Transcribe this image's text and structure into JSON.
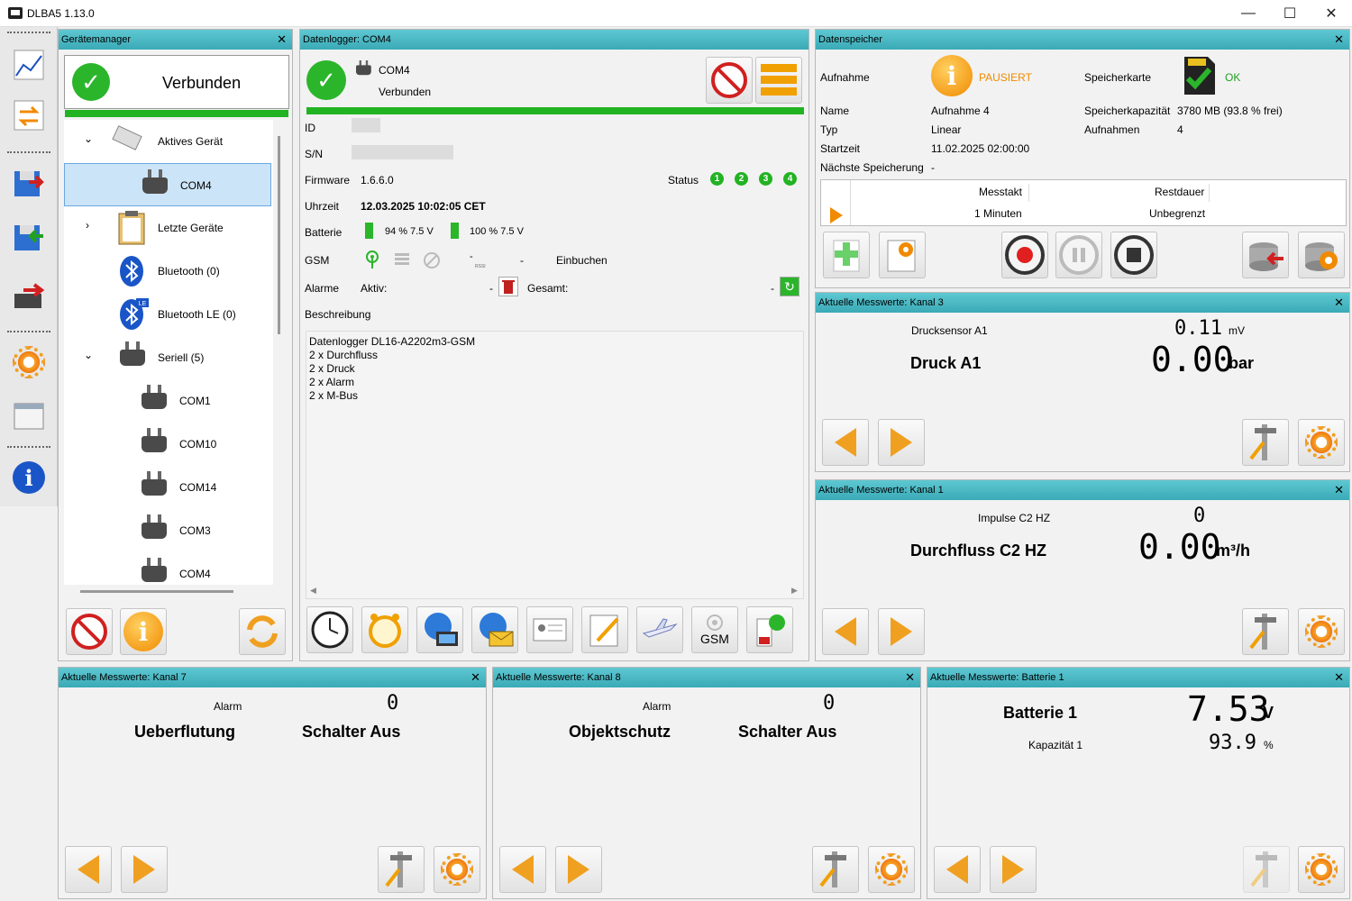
{
  "window": {
    "title": "DLBA5 1.13.0"
  },
  "device_manager": {
    "title": "Gerätemanager",
    "status": "Verbunden",
    "tree": [
      {
        "label": "Aktives Gerät"
      },
      {
        "label": "COM4"
      },
      {
        "label": "Letzte Geräte"
      },
      {
        "label": "Bluetooth (0)"
      },
      {
        "label": "Bluetooth LE (0)"
      },
      {
        "label": "Seriell (5)"
      },
      {
        "label": "COM1"
      },
      {
        "label": "COM10"
      },
      {
        "label": "COM14"
      },
      {
        "label": "COM3"
      },
      {
        "label": "COM4"
      }
    ]
  },
  "datalogger": {
    "title": "Datenlogger: COM4",
    "port": "COM4",
    "status": "Verbunden",
    "id_label": "ID",
    "sn_label": "S/N",
    "firmware_label": "Firmware",
    "firmware": "1.6.6.0",
    "status_label": "Status",
    "leds": [
      "1",
      "2",
      "3",
      "4"
    ],
    "time_label": "Uhrzeit",
    "time": "12.03.2025 10:02:05 CET",
    "battery_label": "Batterie",
    "battery1": "94 %  7.5 V",
    "battery2": "100 %  7.5 V",
    "gsm_label": "GSM",
    "gsm_dash1": "-",
    "gsm_rssi": "RSSI",
    "gsm_dash2": "-",
    "gsm_book": "Einbuchen",
    "alarm_label": "Alarme",
    "alarm_active": "Aktiv:",
    "alarm_dash1": "-",
    "alarm_total": "Gesamt:",
    "alarm_dash2": "-",
    "desc_label": "Beschreibung",
    "desc_lines": [
      "Datenlogger DL16-A2202m3-GSM",
      "2 x Durchfluss",
      "2 x Druck",
      "2 x Alarm",
      "2 x M-Bus"
    ],
    "gsm_btn": "GSM"
  },
  "storage": {
    "title": "Datenspeicher",
    "rec_label": "Aufnahme",
    "rec_state": "PAUSIERT",
    "card_label": "Speicherkarte",
    "card_state": "OK",
    "name_label": "Name",
    "name": "Aufnahme 4",
    "type_label": "Typ",
    "type": "Linear",
    "start_label": "Startzeit",
    "start": "11.02.2025 02:00:00",
    "next_label": "Nächste Speicherung",
    "next": "-",
    "cap_label": "Speicherkapazität",
    "cap": "3780 MB (93.8 % frei)",
    "recs_label": "Aufnahmen",
    "recs": "4",
    "tbl_h1": "Messtakt",
    "tbl_h2": "Restdauer",
    "tbl_v1": "1 Minuten",
    "tbl_v2": "Unbegrenzt"
  },
  "k3": {
    "title": "Aktuelle Messwerte: Kanal 3",
    "sub": "Drucksensor A1",
    "subval": "0.11",
    "subunit": "mV",
    "name": "Druck A1",
    "val": "0.00",
    "unit": "bar"
  },
  "k1": {
    "title": "Aktuelle Messwerte: Kanal 1",
    "sub": "Impulse C2 HZ",
    "subval": "0",
    "name": "Durchfluss C2 HZ",
    "val": "0.00",
    "unit": "m³/h"
  },
  "k7": {
    "title": "Aktuelle Messwerte: Kanal 7",
    "sub": "Alarm",
    "subval": "0",
    "name": "Ueberflutung",
    "val": "Schalter Aus"
  },
  "k8": {
    "title": "Aktuelle Messwerte: Kanal 8",
    "sub": "Alarm",
    "subval": "0",
    "name": "Objektschutz",
    "val": "Schalter Aus"
  },
  "bat": {
    "title": "Aktuelle Messwerte: Batterie 1",
    "name": "Batterie 1",
    "val": "7.53",
    "unit": "V",
    "sub": "Kapazität 1",
    "subval": "93.9",
    "subunit": "%"
  }
}
